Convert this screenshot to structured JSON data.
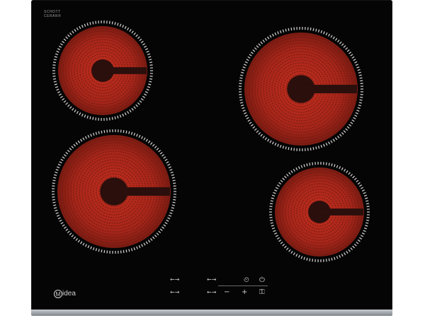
{
  "glass_label": {
    "line1": "SCHOTT",
    "line2": "CERAN®"
  },
  "brand": {
    "logo_letter": "M",
    "rest": "idea"
  },
  "zones": [
    {
      "id": "front-left-top",
      "name": "cooking-zone-rear-left"
    },
    {
      "id": "rear-right",
      "name": "cooking-zone-rear-right"
    },
    {
      "id": "front-left",
      "name": "cooking-zone-front-left"
    },
    {
      "id": "front-right",
      "name": "cooking-zone-front-right"
    }
  ],
  "controls": {
    "zone_select_a": "←→",
    "zone_select_b": "←→",
    "zone_select_c": "←→",
    "zone_select_d": "←→",
    "timer_symbol": "⏲",
    "power_symbol": "⏻",
    "minus": "−",
    "plus": "+",
    "lock_symbol": "⚿"
  },
  "colors": {
    "glass": "#050505",
    "element": "#b3261a",
    "element_dark": "#6e1a12",
    "ring": "#d9d9d9"
  }
}
